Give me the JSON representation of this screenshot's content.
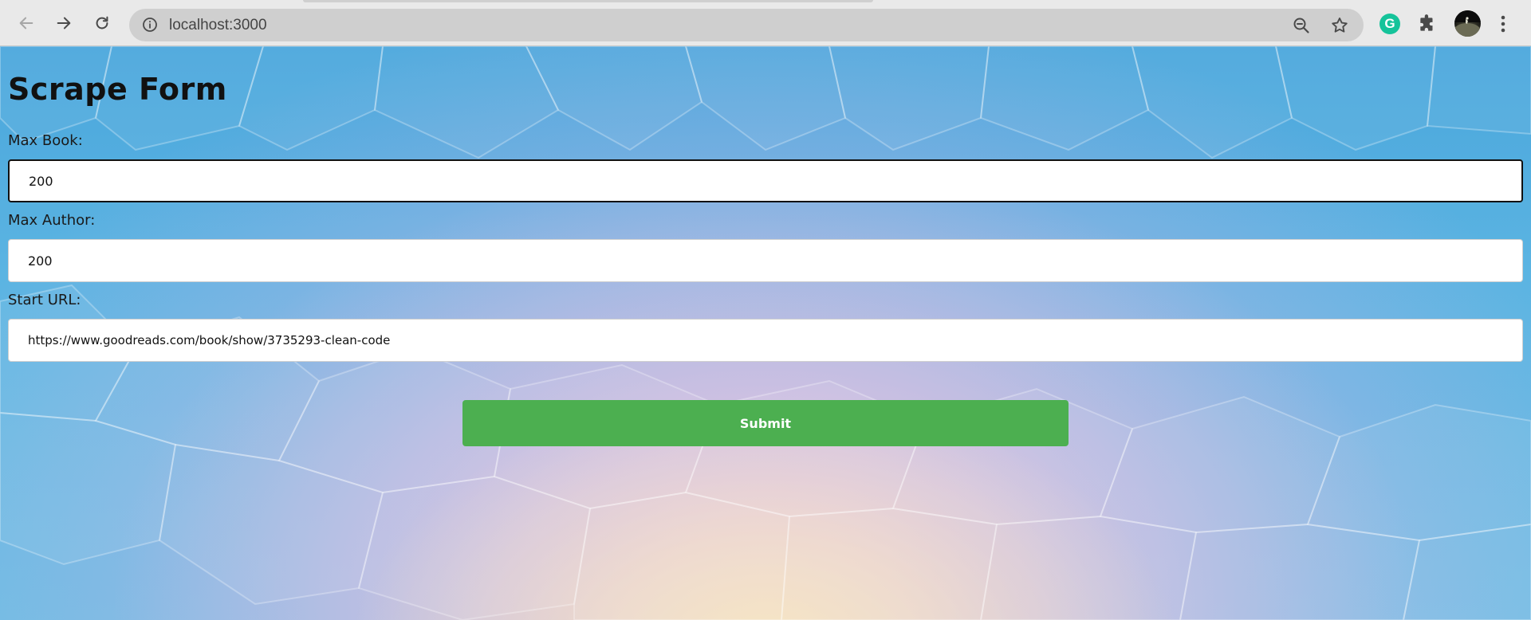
{
  "browser": {
    "url": "localhost:3000",
    "icons": {
      "back": "arrow-left-icon",
      "forward": "arrow-right-icon",
      "reload": "reload-icon",
      "site_info": "info-icon",
      "zoom": "zoom-out-icon",
      "bookmark": "star-icon",
      "grammarly": "grammarly-icon",
      "extensions": "puzzle-icon",
      "profile": "avatar",
      "menu": "kebab-menu-icon"
    },
    "grammarly_letter": "G"
  },
  "form": {
    "title": "Scrape Form",
    "fields": [
      {
        "label": "Max Book:",
        "value": "200"
      },
      {
        "label": "Max Author:",
        "value": "200"
      },
      {
        "label": "Start URL:",
        "value": "https://www.goodreads.com/book/show/3735293-clean-code"
      }
    ],
    "submit_label": "Submit"
  },
  "colors": {
    "submit_button": "#4caf50",
    "grammarly": "#15c39a"
  }
}
